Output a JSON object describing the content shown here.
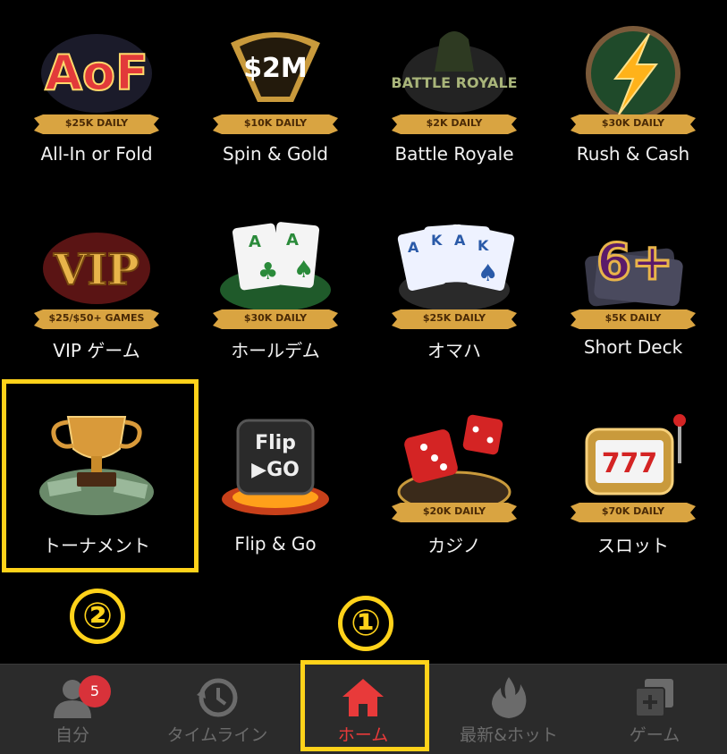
{
  "games": [
    {
      "label": "All-In or Fold",
      "banner": "$25K DAILY",
      "art_text": "AoF",
      "icon": "aof-icon"
    },
    {
      "label": "Spin & Gold",
      "banner": "$10K DAILY",
      "art_text": "$2M",
      "icon": "spin-gold-icon"
    },
    {
      "label": "Battle Royale",
      "banner": "$2K DAILY",
      "art_text": "BATTLE ROYALE",
      "icon": "battle-royale-icon"
    },
    {
      "label": "Rush & Cash",
      "banner": "$30K DAILY",
      "art_text": "",
      "icon": "lightning-icon"
    },
    {
      "label": "VIP ゲーム",
      "banner": "$25/$50+ GAMES",
      "art_text": "VIP",
      "icon": "vip-icon"
    },
    {
      "label": "ホールデム",
      "banner": "$30K DAILY",
      "art_text": "A A",
      "icon": "holdem-cards-icon"
    },
    {
      "label": "オマハ",
      "banner": "$25K DAILY",
      "art_text": "A K A K",
      "icon": "omaha-cards-icon"
    },
    {
      "label": "Short Deck",
      "banner": "$5K DAILY",
      "art_text": "6+",
      "icon": "short-deck-icon"
    },
    {
      "label": "トーナメント",
      "banner": "",
      "art_text": "",
      "icon": "trophy-icon"
    },
    {
      "label": "Flip & Go",
      "banner": "",
      "art_text": "Flip ▶GO",
      "icon": "flip-go-icon"
    },
    {
      "label": "カジノ",
      "banner": "$20K DAILY",
      "art_text": "",
      "icon": "casino-dice-icon"
    },
    {
      "label": "スロット",
      "banner": "$70K DAILY",
      "art_text": "777",
      "icon": "slot-machine-icon"
    }
  ],
  "annotations": {
    "one": "①",
    "two": "②"
  },
  "tabs": [
    {
      "label": "自分",
      "icon": "profile-icon",
      "badge": "5"
    },
    {
      "label": "タイムライン",
      "icon": "timeline-icon"
    },
    {
      "label": "ホーム",
      "icon": "home-icon"
    },
    {
      "label": "最新&ホット",
      "icon": "flame-icon"
    },
    {
      "label": "ゲーム",
      "icon": "games-icon"
    }
  ],
  "colors": {
    "highlight": "#ffd21a",
    "active_tab": "#e83a3a",
    "tabbar_bg": "#2b2b2b",
    "banner_gold": "#d9a441"
  }
}
